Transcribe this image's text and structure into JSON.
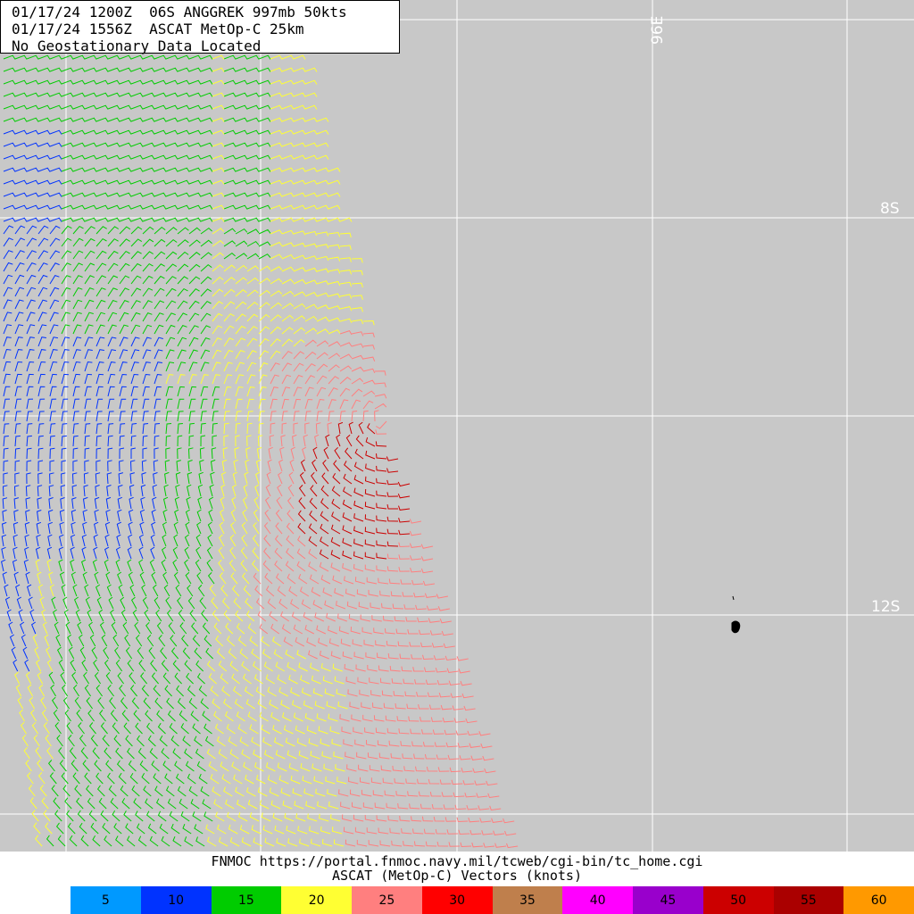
{
  "header": {
    "line1": "01/17/24 1200Z  06S ANGGREK 997mb 50kts",
    "line2": "01/17/24 1556Z  ASCAT MetOp-C 25km",
    "line3": "No Geostationary Data Located"
  },
  "grid_labels": {
    "lon_96e": "96E",
    "lat_8s": "8S",
    "lat_12s": "12S"
  },
  "footer": {
    "credit": "FNMOC https://portal.fnmoc.navy.mil/tcweb/cgi-bin/tc_home.cgi",
    "legend_title": "ASCAT (MetOp-C) Vectors (knots)"
  },
  "legend": [
    {
      "label": "5",
      "color": "#0099ff"
    },
    {
      "label": "10",
      "color": "#0033ff"
    },
    {
      "label": "15",
      "color": "#00cc00"
    },
    {
      "label": "20",
      "color": "#ffff33"
    },
    {
      "label": "25",
      "color": "#ff7f7f"
    },
    {
      "label": "30",
      "color": "#ff0000"
    },
    {
      "label": "35",
      "color": "#bf7f4c"
    },
    {
      "label": "40",
      "color": "#ff00ff"
    },
    {
      "label": "45",
      "color": "#9900cc"
    },
    {
      "label": "50",
      "color": "#cc0000"
    },
    {
      "label": "55",
      "color": "#aa0000"
    },
    {
      "label": "60",
      "color": "#ff9900"
    }
  ],
  "colors": {
    "map_background": "#c8c8c8",
    "grid_line": "#ffffff"
  }
}
